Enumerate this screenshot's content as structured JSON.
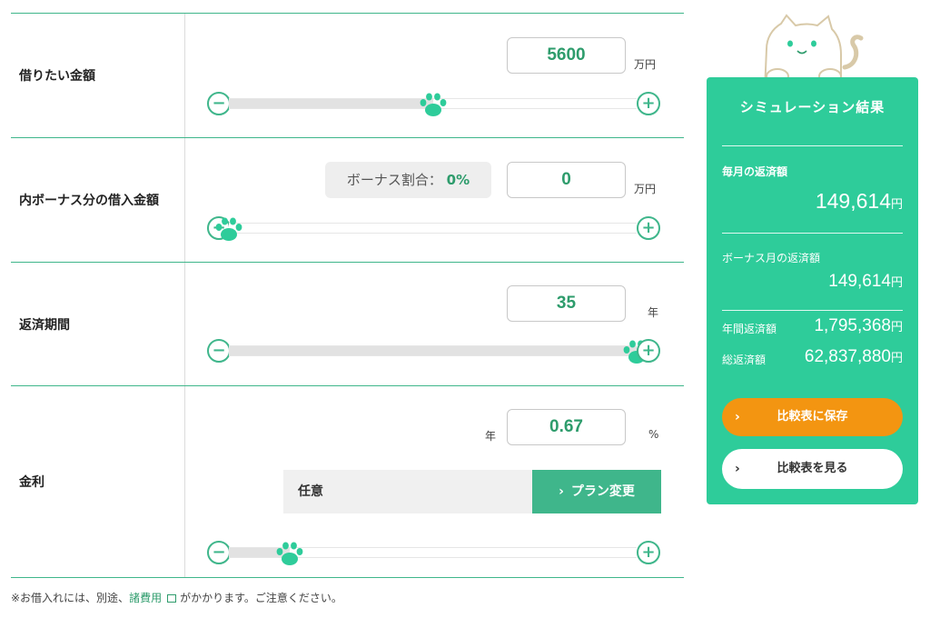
{
  "rows": {
    "loan_amount": {
      "label": "借りたい金額",
      "value": "5600",
      "unit": "万円",
      "slider_fraction": 0.5
    },
    "bonus_amount": {
      "label": "内ボーナス分の借入金額",
      "bonus_ratio_label": "ボーナス割合：",
      "bonus_ratio_value": "0%",
      "value": "0",
      "unit": "万円",
      "slider_fraction": 0.0
    },
    "repayment_period": {
      "label": "返済期間",
      "value": "35",
      "unit": "年",
      "slider_fraction": 1.0
    },
    "interest_rate": {
      "label": "金利",
      "prefix": "年",
      "value": "0.67",
      "unit": "%",
      "plan_name": "任意",
      "plan_button_label": "プラン変更",
      "slider_fraction": 0.15
    }
  },
  "controls": {
    "minus_symbol": "−",
    "plus_symbol": "+",
    "chevron": "›"
  },
  "note": {
    "prefix": "※お借入れには、別途、",
    "link": "諸費用",
    "suffix": "がかかります。ご注意ください。"
  },
  "result": {
    "title": "シミュレーション結果",
    "monthly_label": "毎月の返済額",
    "monthly_value": "149,614",
    "bonus_month_label": "ボーナス月の返済額",
    "bonus_month_value": "149,614",
    "annual_label": "年間返済額",
    "annual_value": "1,795,368",
    "total_label": "総返済額",
    "total_value": "62,837,880",
    "yen": "円",
    "save_button": "比較表に保存",
    "view_button": "比較表を見る"
  },
  "colors": {
    "accent": "#3fb68b",
    "panel": "#2ecc9a",
    "save": "#f39511"
  }
}
